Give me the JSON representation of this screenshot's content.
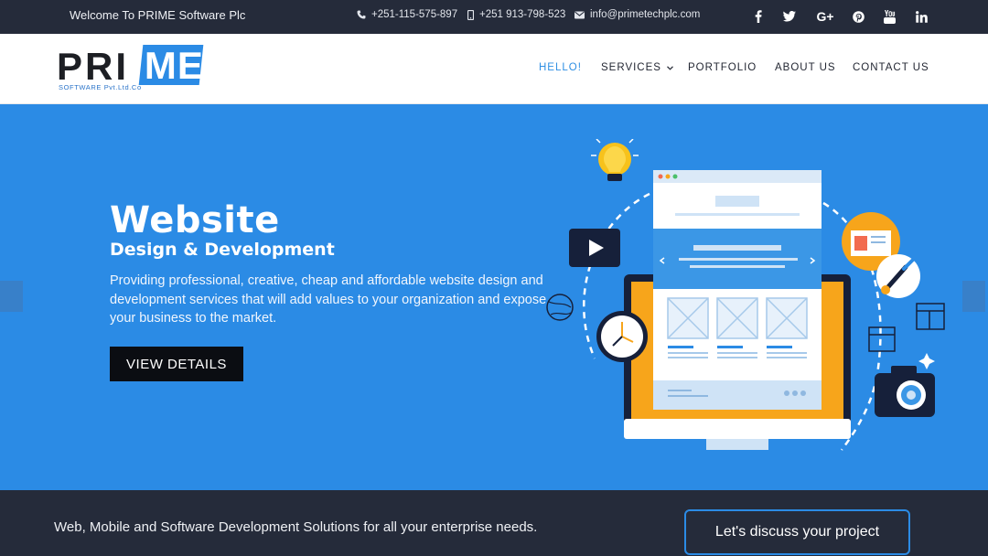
{
  "topbar": {
    "welcome": "Welcome To PRIME Software Plc",
    "phone1": "+251-115-575-897",
    "phone2": "+251 913-798-523",
    "email": "info@primetechplc.com",
    "social": [
      "facebook",
      "twitter",
      "google-plus",
      "pinterest",
      "youtube",
      "linkedin"
    ]
  },
  "logo": {
    "part1": "PRI",
    "part2": "ME",
    "tagline": "SOFTWARE Pvt.Ltd.Co"
  },
  "nav": {
    "items": [
      {
        "label": "HELLO!",
        "active": true
      },
      {
        "label": "SERVICES",
        "dropdown": true
      },
      {
        "label": "PORTFOLIO"
      },
      {
        "label": "ABOUT US"
      },
      {
        "label": "CONTACT US"
      }
    ]
  },
  "hero": {
    "title": "Website",
    "subtitle": "Design & Development",
    "description": "Providing professional, creative, cheap and affordable website design and development services that will add values to your organization and expose your business to the market.",
    "button": "VIEW DETAILS"
  },
  "strip": {
    "tagline": "Web, Mobile and Software Development Solutions for all your enterprise needs.",
    "button": "Let's discuss your project"
  },
  "colors": {
    "accent": "#2b8be5",
    "dark": "#252b3a"
  }
}
